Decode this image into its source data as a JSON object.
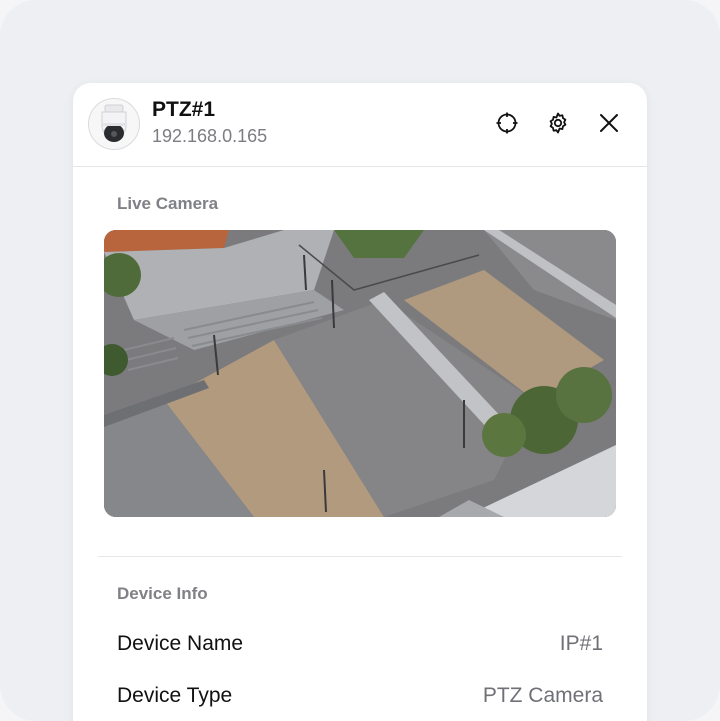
{
  "camera": {
    "name": "PTZ#1",
    "ip": "192.168.0.165"
  },
  "header_icons": [
    "crosshair-icon",
    "gear-icon",
    "close-icon"
  ],
  "live": {
    "label": "Live Camera"
  },
  "device_info": {
    "label": "Device Info",
    "rows": [
      {
        "key": "Device Name",
        "value": "IP#1"
      },
      {
        "key": "Device Type",
        "value": "PTZ Camera"
      }
    ]
  },
  "colors": {
    "accent": "#111111",
    "muted": "#7c7d82",
    "background": "#eeeff3"
  }
}
